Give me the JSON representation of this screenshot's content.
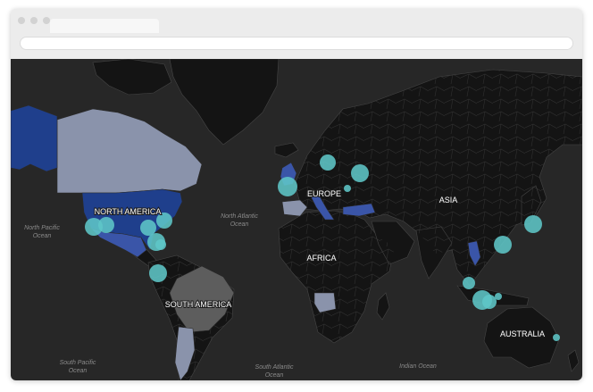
{
  "browser": {
    "tab_title": "",
    "address": ""
  },
  "map": {
    "theme": "dark",
    "colors": {
      "ocean": "#272727",
      "land": "#141414",
      "borders": "#4a4a4a",
      "highlight_dark_blue": "#1f3f8c",
      "highlight_mid_blue": "#3a55a8",
      "highlight_light": "#8a93ab",
      "highlight_gray": "#5d5d5d",
      "bubble": "#5fc6c7"
    },
    "region_labels": {
      "north_america": "NORTH AMERICA",
      "south_america": "SOUTH AMERICA",
      "europe": "EUROPE",
      "africa": "AFRICA",
      "asia": "ASIA",
      "australia": "AUSTRALIA"
    },
    "ocean_labels": {
      "north_pacific_1": "North Pacific",
      "north_pacific_2": "Ocean",
      "north_atlantic_1": "North Atlantic",
      "north_atlantic_2": "Ocean",
      "south_pacific_1": "South Pacific",
      "south_pacific_2": "Ocean",
      "south_atlantic_1": "South Atlantic",
      "south_atlantic_2": "Ocean",
      "indian": "Indian Ocean"
    },
    "highlighted_countries": [
      {
        "name": "United States",
        "shade": "dark-blue"
      },
      {
        "name": "Alaska",
        "shade": "dark-blue"
      },
      {
        "name": "Canada",
        "shade": "light"
      },
      {
        "name": "Mexico",
        "shade": "mid-blue"
      },
      {
        "name": "United Kingdom",
        "shade": "mid-blue"
      },
      {
        "name": "Spain",
        "shade": "light"
      },
      {
        "name": "Italy",
        "shade": "mid-blue"
      },
      {
        "name": "Turkey",
        "shade": "mid-blue"
      },
      {
        "name": "Thailand",
        "shade": "mid-blue"
      },
      {
        "name": "Brazil",
        "shade": "gray"
      },
      {
        "name": "Argentina",
        "shade": "light"
      },
      {
        "name": "Angola",
        "shade": "light"
      }
    ],
    "bubbles": [
      {
        "place": "San Francisco",
        "size": "large"
      },
      {
        "place": "Los Angeles",
        "size": "large"
      },
      {
        "place": "New York",
        "size": "medium"
      },
      {
        "place": "Texas",
        "size": "medium"
      },
      {
        "place": "Florida",
        "size": "medium"
      },
      {
        "place": "Cuba",
        "size": "medium"
      },
      {
        "place": "Colombia",
        "size": "medium"
      },
      {
        "place": "London",
        "size": "large"
      },
      {
        "place": "Sweden",
        "size": "medium"
      },
      {
        "place": "Moscow",
        "size": "medium"
      },
      {
        "place": "Poland",
        "size": "small"
      },
      {
        "place": "Tokyo",
        "size": "medium"
      },
      {
        "place": "Hong Kong",
        "size": "medium"
      },
      {
        "place": "Malaysia",
        "size": "small"
      },
      {
        "place": "Jakarta",
        "size": "large"
      },
      {
        "place": "Bali",
        "size": "small"
      },
      {
        "place": "Sydney",
        "size": "small"
      }
    ]
  }
}
